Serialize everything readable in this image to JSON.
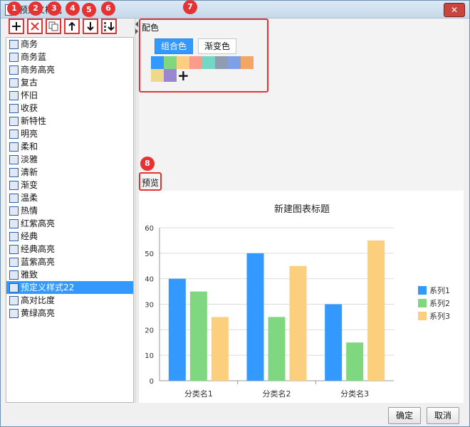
{
  "window": {
    "title": "预定义样式"
  },
  "toolbar": {
    "buttons": [
      {
        "num": "1",
        "icon": "plus-icon"
      },
      {
        "num": "2",
        "icon": "delete-x-icon"
      },
      {
        "num": "3",
        "icon": "copy-icon"
      },
      {
        "num": "4",
        "icon": "arrow-up-icon"
      },
      {
        "num": "5",
        "icon": "arrow-down-icon"
      },
      {
        "num": "6",
        "icon": "sort-icon"
      }
    ]
  },
  "style_list": [
    "商务",
    "商务蓝",
    "商务高亮",
    "复古",
    "怀旧",
    "收获",
    "新特性",
    "明亮",
    "柔和",
    "淡雅",
    "清新",
    "渐变",
    "温柔",
    "热情",
    "红紫高亮",
    "经典",
    "经典高亮",
    "蓝紫高亮",
    "雅致",
    "预定义样式22",
    "高对比度",
    "黄绿高亮"
  ],
  "selected_index": 19,
  "color_section": {
    "title": "配色",
    "num": "7",
    "tabs": [
      "组合色",
      "渐变色"
    ],
    "active_tab": "组合色",
    "swatches": [
      "#3399ff",
      "#7fd87f",
      "#fccf7e",
      "#fc9a8c",
      "#72d8c4",
      "#8f9db3",
      "#7f9fe8",
      "#f3a664",
      "#eed98a",
      "#9a86d1"
    ],
    "add_label": "+"
  },
  "preview": {
    "num": "8",
    "label": "预览"
  },
  "chart_data": {
    "type": "bar",
    "title": "新建图表标题",
    "categories": [
      "分类名1",
      "分类名2",
      "分类名3"
    ],
    "series": [
      {
        "name": "系列1",
        "values": [
          40,
          50,
          30
        ],
        "color": "#3399ff"
      },
      {
        "name": "系列2",
        "values": [
          35,
          25,
          15
        ],
        "color": "#7fd87f"
      },
      {
        "name": "系列3",
        "values": [
          25,
          45,
          55
        ],
        "color": "#fccf7e"
      }
    ],
    "ylim": [
      0,
      60
    ],
    "yticks": [
      "0",
      "10",
      "20",
      "30",
      "40",
      "50",
      "60"
    ],
    "grid": true,
    "legend": "right"
  },
  "footer": {
    "ok_label": "确定",
    "cancel_label": "取消"
  }
}
